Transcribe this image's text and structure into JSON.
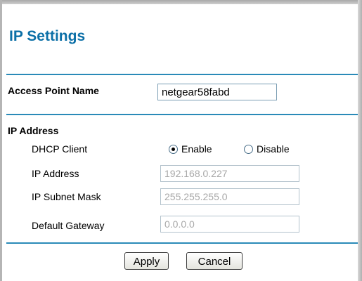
{
  "page": {
    "title": "IP Settings"
  },
  "access_point": {
    "label": "Access Point Name",
    "value": "netgear58fabd"
  },
  "ip_address": {
    "section_label": "IP Address",
    "dhcp": {
      "label": "DHCP Client",
      "options": [
        "Enable",
        "Disable"
      ],
      "selected": "Enable"
    },
    "fields": [
      {
        "label": "IP Address",
        "value": "192.168.0.227"
      },
      {
        "label": "IP Subnet Mask",
        "value": "255.255.255.0"
      },
      {
        "label": "Default Gateway",
        "value": "0.0.0.0"
      }
    ]
  },
  "buttons": {
    "apply": "Apply",
    "cancel": "Cancel"
  },
  "colors": {
    "accent": "#0b6fa7",
    "rule": "#2a8ab8",
    "disabled_text": "#a8a8a8"
  }
}
